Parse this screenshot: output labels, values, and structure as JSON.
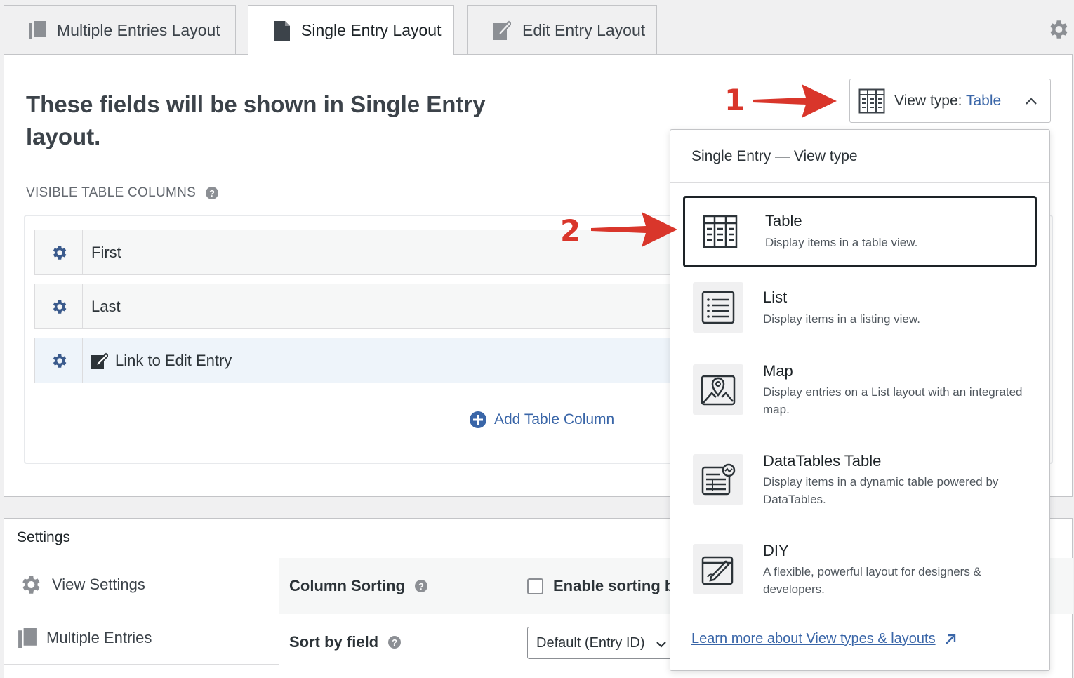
{
  "tabs": [
    {
      "label": "Multiple Entries Layout",
      "icon": "stack-pages-icon"
    },
    {
      "label": "Single Entry Layout",
      "icon": "document-icon"
    },
    {
      "label": "Edit Entry Layout",
      "icon": "edit-icon"
    }
  ],
  "main": {
    "heading": "These fields will be shown in Single Entry layout.",
    "section_label": "VISIBLE TABLE COLUMNS",
    "fields": [
      {
        "label": "First"
      },
      {
        "label": "Last"
      },
      {
        "label": "Link to Edit Entry"
      }
    ],
    "add_column_label": "Add Table Column"
  },
  "view_type": {
    "prefix": "View type:",
    "value": "Table"
  },
  "dropdown": {
    "title": "Single Entry — View type",
    "options": [
      {
        "title": "Table",
        "desc": "Display items in a table view.",
        "icon": "table-icon",
        "selected": true
      },
      {
        "title": "List",
        "desc": "Display items in a listing view.",
        "icon": "list-icon"
      },
      {
        "title": "Map",
        "desc": "Display entries on a List layout with an integrated map.",
        "icon": "map-icon"
      },
      {
        "title": "DataTables Table",
        "desc": "Display items in a dynamic table powered by DataTables.",
        "icon": "datatables-icon"
      },
      {
        "title": "DIY",
        "desc": "A flexible, powerful layout for designers & developers.",
        "icon": "diy-icon"
      }
    ],
    "learn_more": "Learn more about View types & layouts"
  },
  "settings": {
    "title": "Settings",
    "sidebar": [
      {
        "label": "View Settings",
        "icon": "gear-icon"
      },
      {
        "label": "Multiple Entries",
        "icon": "stack-pages-icon"
      }
    ],
    "rows": [
      {
        "name": "Column Sorting",
        "checkbox_label": "Enable sorting b"
      },
      {
        "name": "Sort by field",
        "select_value": "Default (Entry ID)"
      }
    ]
  },
  "annotations": [
    "1",
    "2"
  ],
  "colors": {
    "accent": "#3a66a8",
    "annotation": "#d9362b"
  }
}
